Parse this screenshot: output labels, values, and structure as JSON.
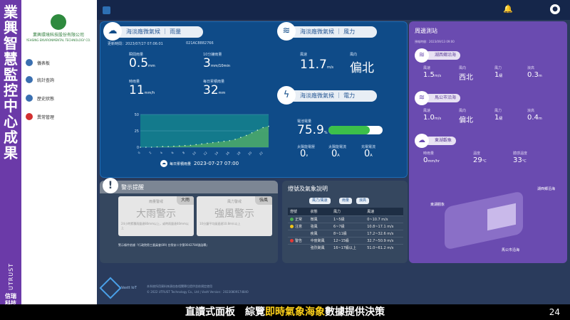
{
  "vertical_title": "業興智慧監控中心成果",
  "brand": {
    "u_text": "UTRUST",
    "name_line1": "信瑞",
    "name_line2": "科技"
  },
  "sidebar": {
    "company_name": "業興環境科技股份有限公司",
    "company_en": "YEHSING ENVIRONMENTAL TECHNOLOGY CO.",
    "items": [
      {
        "label": "儀表板",
        "color": "#3a6fb0"
      },
      {
        "label": "統計查詢",
        "color": "#3a6fb0"
      },
      {
        "label": "歷史狀態",
        "color": "#3a6fb0"
      },
      {
        "label": "異常管理",
        "color": "#d23030"
      }
    ],
    "menu_icon": "hamburger-icon"
  },
  "topbar": {
    "logo_icon": "app-logo-icon",
    "bell_icon": "bell-icon",
    "user_icon": "user-icon"
  },
  "rain": {
    "header": "海淡廠微氣候",
    "header_sub": "雨量",
    "icon": "cloud-rain-icon",
    "update_label": "更新時間：2023/07/27 07:06:01",
    "device_id": "021AC8882766",
    "m1_label": "瞬間雨量",
    "m1_value": "0.5",
    "m1_unit": "mm",
    "m2_label": "10分鐘雨量",
    "m2_value": "3",
    "m2_unit": "mm/10min",
    "m3_label": "時雨量",
    "m3_value": "11",
    "m3_unit": "mm/h",
    "m4_label": "每日累積雨量",
    "m4_value": "32",
    "m4_unit": "mm",
    "daily_label": "每日累積雨量",
    "daily_date": "2023-07-27 07:00"
  },
  "chart_data": {
    "type": "area",
    "ylim": [
      0,
      50
    ],
    "yticks": [
      "50",
      "25",
      "0"
    ],
    "x": [
      "0",
      "1",
      "2",
      "3",
      "4",
      "5",
      "6",
      "7",
      "8",
      "9",
      "10",
      "11",
      "12",
      "13",
      "14",
      "15",
      "16",
      "17",
      "18",
      "19",
      "20",
      "21",
      "22",
      "23"
    ],
    "values": [
      0,
      0,
      0,
      0.5,
      1,
      1,
      1.5,
      2,
      2.5,
      3,
      4,
      5,
      6,
      7,
      8,
      9,
      10,
      12,
      15,
      18,
      22,
      26,
      30,
      32
    ],
    "color": "#4aa56a"
  },
  "wind": {
    "header": "海淡廠微氣候",
    "header_sub": "風力",
    "icon": "wind-icon",
    "speed_label": "風速",
    "speed_value": "11.7",
    "speed_unit": "m/s",
    "dir_label": "風向",
    "dir_value": "偏北"
  },
  "power": {
    "header": "海淡廠微氣候",
    "header_sub": "電力",
    "icon": "lightning-icon",
    "battery_label": "電池電量",
    "battery_value": "75.9",
    "battery_unit": "%",
    "battery_fraction": 0.759,
    "solar_label": "太陽能電壓",
    "solar_value": "0",
    "solar_unit": "v",
    "solar_current_label": "太陽能電流",
    "solar_current_value": "0",
    "solar_current_unit": "A",
    "charge_label": "充電電流",
    "charge_value": "0",
    "charge_unit": "A"
  },
  "around": {
    "header": "周邊測站",
    "date": "預報時間：2023/09/13 09:00",
    "stations": [
      {
        "name": "湖西鄉沿海",
        "icon": "wind-icon",
        "l1": "風速",
        "v1": "1.5",
        "u1": "m/s",
        "l2": "風向",
        "v2": "西北",
        "l3": "風力",
        "v3": "1",
        "u3": "級",
        "l4": "浪高",
        "v4": "0.3",
        "u4": "m"
      },
      {
        "name": "馬公市沿海",
        "icon": "wind-icon",
        "l1": "風速",
        "v1": "1.0",
        "u1": "m/s",
        "l2": "風向",
        "v2": "偏北",
        "l3": "風力",
        "v3": "1",
        "u3": "級",
        "l4": "浪高",
        "v4": "0.4",
        "u4": "m"
      },
      {
        "name": "東湖觀象",
        "icon": "cloud-icon",
        "l1": "時雨量",
        "v1": "0",
        "u1": "mm/hr",
        "l2": "溫度",
        "v2": "29",
        "u2": "°C",
        "l3": "體感溫度",
        "v3": "33",
        "u3": "°C"
      }
    ],
    "map_labels": [
      "湖西鄉沿海",
      "東湖觀象",
      "馬公市沿海"
    ]
  },
  "alert": {
    "header": "警示提醒",
    "icon": "alert-icon",
    "cards": [
      {
        "title": "雨量警戒",
        "badge": "大雨",
        "word": "大雨警示",
        "desc": "24小時累積雨量達80mm以上，或時雨量達40mm以上"
      },
      {
        "title": "風力警戒",
        "badge": "強風",
        "word": "強風警示",
        "desc": "10分鐘平均風速達10.8m/s以上"
      }
    ],
    "note": "警示條件依據『行政院勞工委員會(89) 台勞安二字第0042784號函釋』"
  },
  "legend": {
    "header": "燈號及氣象說明",
    "tabs": [
      "風力/風速",
      "雨量",
      "浪高"
    ],
    "columns": [
      "燈號",
      "狀態",
      "風力",
      "風速"
    ],
    "rows": [
      {
        "color": "#4caf50",
        "light": "正常",
        "state": "微風",
        "force": "1~5級",
        "speed": "0~10.7 m/s"
      },
      {
        "color": "#f0c419",
        "light": "注意",
        "state": "強風",
        "force": "6~7級",
        "speed": "10.8~17.1 m/s"
      },
      {
        "color": "",
        "light": "",
        "state": "疾風",
        "force": "8~11級",
        "speed": "17.2~32.6 m/s"
      },
      {
        "color": "#e53935",
        "light": "警告",
        "state": "中度颱風",
        "force": "12~15級",
        "speed": "32.7~50.9 m/s"
      },
      {
        "color": "",
        "light": "",
        "state": "強烈颱風",
        "force": "16~17級以上",
        "speed": "51.0~61.2 m/s"
      }
    ]
  },
  "footer": {
    "line1": "本系統所用資料來源由各相關單位提供並依規定使用",
    "line2": "© 2022 UTRUST Technology Co., Ltd | Vastt Version：20230809174840",
    "logo_text": "Vastt IoT"
  },
  "caption": {
    "part1": "直讀式面板　綜覽",
    "part2": "即時氣象海象",
    "part3": "數據提供決策"
  },
  "page_number": "24"
}
